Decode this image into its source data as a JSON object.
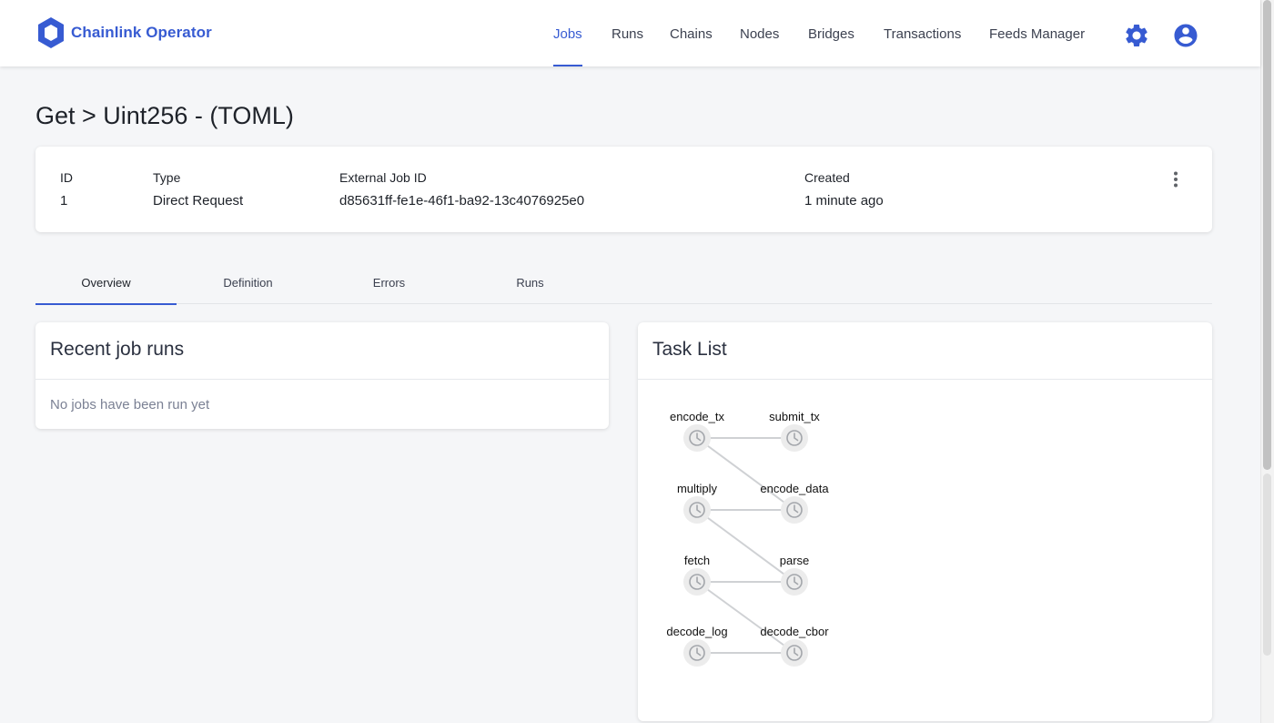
{
  "app": {
    "name": "Chainlink Operator",
    "colors": {
      "brand": "#375bd2",
      "background": "#f5f6f8",
      "card": "#ffffff"
    }
  },
  "nav": {
    "items": [
      {
        "label": "Jobs",
        "active": true
      },
      {
        "label": "Runs"
      },
      {
        "label": "Chains"
      },
      {
        "label": "Nodes"
      },
      {
        "label": "Bridges"
      },
      {
        "label": "Transactions"
      },
      {
        "label": "Feeds Manager"
      }
    ],
    "icons": [
      "gear-icon",
      "account-circle-icon"
    ]
  },
  "page": {
    "title": "Get > Uint256 - (TOML)"
  },
  "job": {
    "id_label": "ID",
    "id_value": "1",
    "type_label": "Type",
    "type_value": "Direct Request",
    "external_label": "External Job ID",
    "external_value": "d85631ff-fe1e-46f1-ba92-13c4076925e0",
    "created_label": "Created",
    "created_value": "1 minute ago"
  },
  "tabs": [
    {
      "label": "Overview",
      "active": true
    },
    {
      "label": "Definition"
    },
    {
      "label": "Errors"
    },
    {
      "label": "Runs"
    }
  ],
  "recent_runs": {
    "title": "Recent job runs",
    "empty": "No jobs have been run yet"
  },
  "task_list": {
    "title": "Task List",
    "tasks": [
      {
        "name": "encode_tx",
        "status": "pending",
        "status_icon": "clock-icon"
      },
      {
        "name": "submit_tx",
        "status": "pending",
        "status_icon": "clock-icon"
      },
      {
        "name": "multiply",
        "status": "pending",
        "status_icon": "clock-icon"
      },
      {
        "name": "encode_data",
        "status": "pending",
        "status_icon": "clock-icon"
      },
      {
        "name": "fetch",
        "status": "pending",
        "status_icon": "clock-icon"
      },
      {
        "name": "parse",
        "status": "pending",
        "status_icon": "clock-icon"
      },
      {
        "name": "decode_log",
        "status": "pending",
        "status_icon": "clock-icon"
      },
      {
        "name": "decode_cbor",
        "status": "pending",
        "status_icon": "clock-icon"
      }
    ],
    "edges": [
      [
        "decode_log",
        "decode_cbor"
      ],
      [
        "decode_cbor",
        "fetch"
      ],
      [
        "fetch",
        "parse"
      ],
      [
        "parse",
        "multiply"
      ],
      [
        "multiply",
        "encode_data"
      ],
      [
        "encode_data",
        "encode_tx"
      ],
      [
        "encode_tx",
        "submit_tx"
      ]
    ]
  }
}
